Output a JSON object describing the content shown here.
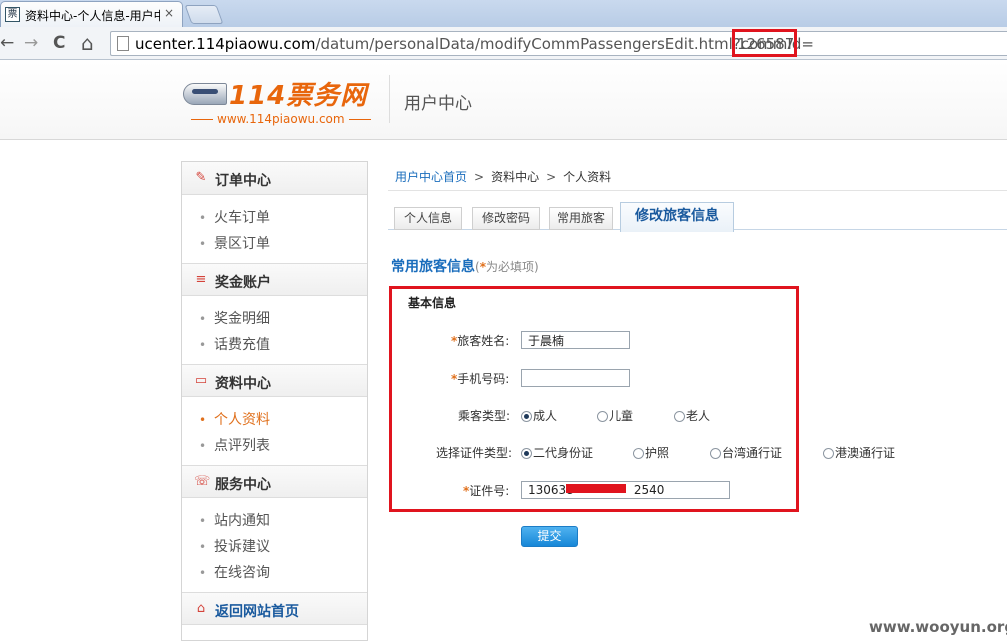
{
  "browser": {
    "tab_title": "资料中心-个人信息-用户中",
    "tab_close": "×",
    "favicon": "票",
    "url_host": "ucenter.114piaowu.com",
    "url_path": "/datum/personalData/modifyCommPassengersEdit.html?commId=",
    "url_highlight": "126587",
    "nav_back": "←",
    "nav_forward": "→",
    "nav_reload": "C",
    "nav_home": "⌂"
  },
  "header": {
    "brand": "114票务网",
    "domain": "www.114piaowu.com",
    "section": "用户中心"
  },
  "sidebar": {
    "groups": [
      {
        "title": "订单中心",
        "icon": "order-icon",
        "glyph": "✎",
        "items": [
          "火车订单",
          "景区订单"
        ]
      },
      {
        "title": "奖金账户",
        "icon": "coins-icon",
        "glyph": "≡",
        "items": [
          "奖金明细",
          "话费充值"
        ]
      },
      {
        "title": "资料中心",
        "icon": "folder-icon",
        "glyph": "▭",
        "items": [
          "个人资料",
          "点评列表"
        ]
      },
      {
        "title": "服务中心",
        "icon": "phone-icon",
        "glyph": "☏",
        "items": [
          "站内通知",
          "投诉建议",
          "在线咨询"
        ]
      }
    ],
    "home": {
      "title": "返回网站首页",
      "icon": "home-icon",
      "glyph": "⌂"
    }
  },
  "breadcrumb": {
    "home": "用户中心首页",
    "level1": "资料中心",
    "level2": "个人资料",
    "sep": ">"
  },
  "tabs": [
    "个人信息",
    "修改密码",
    "常用旅客",
    "修改旅客信息"
  ],
  "section": {
    "title": "常用旅客信息",
    "note_open": "(",
    "note_star": "*",
    "note_text": "为必填项)"
  },
  "form": {
    "box_title": "基本信息",
    "star": "*",
    "name_label": "旅客姓名:",
    "name_value": "于晨楠",
    "phone_label": "手机号码:",
    "phone_value": "",
    "type_label": "乘客类型:",
    "type_options": [
      "成人",
      "儿童",
      "老人"
    ],
    "type_selected": 0,
    "id_type_label": "选择证件类型:",
    "id_type_options": [
      "二代身份证",
      "护照",
      "台湾通行证",
      "港澳通行证"
    ],
    "id_type_selected": 0,
    "id_label": "证件号:",
    "id_value_start": "130638",
    "id_value_end": "2540",
    "submit": "提交"
  },
  "watermark": "www.wooyun.org",
  "colors": {
    "accent": "#1a6dbc",
    "highlight": "#e0141e",
    "orange": "#e0701c"
  }
}
